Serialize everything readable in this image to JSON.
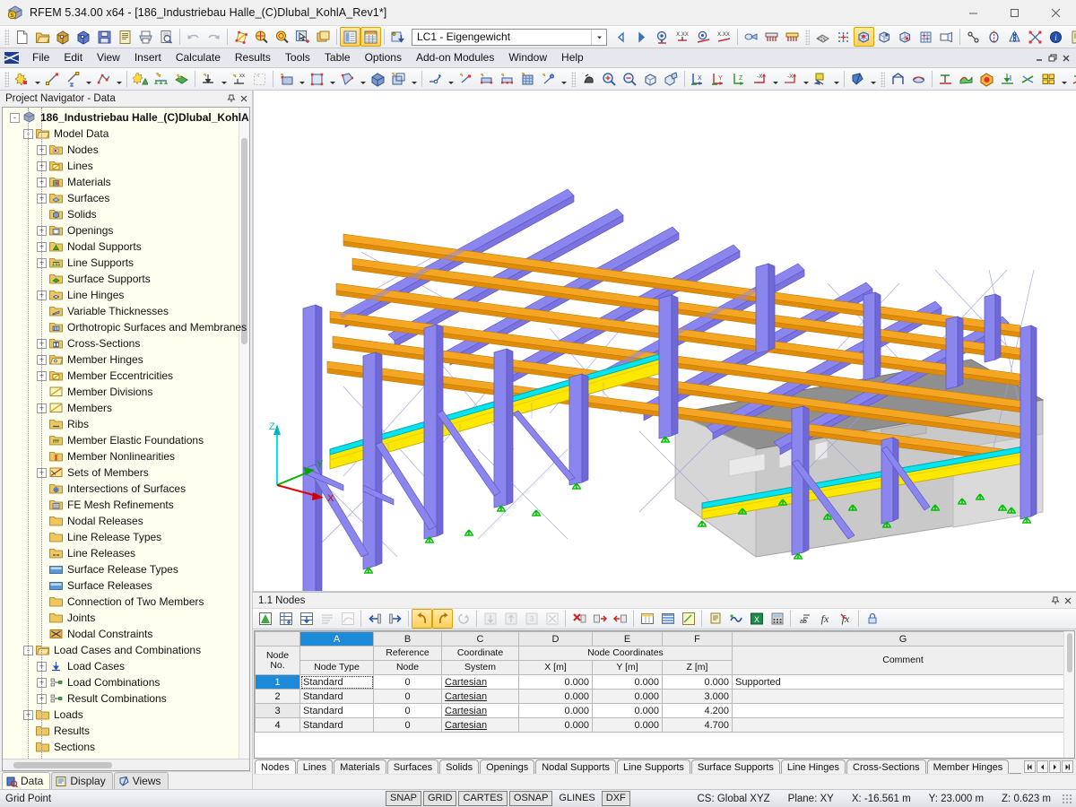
{
  "window": {
    "title": "RFEM 5.34.00 x64 - [186_Industriebau Halle_(C)Dlubal_KohlA_Rev1*]",
    "minimize": "—",
    "maximize": "□",
    "close": "✕"
  },
  "menu": {
    "items": [
      {
        "label": "File"
      },
      {
        "label": "Edit"
      },
      {
        "label": "View"
      },
      {
        "label": "Insert"
      },
      {
        "label": "Calculate"
      },
      {
        "label": "Results"
      },
      {
        "label": "Tools"
      },
      {
        "label": "Table"
      },
      {
        "label": "Options"
      },
      {
        "label": "Add-on Modules"
      },
      {
        "label": "Window"
      },
      {
        "label": "Help"
      }
    ],
    "mdi": {
      "minimize": "–",
      "restore": "❐",
      "close": "✕"
    }
  },
  "toolbar": {
    "load_case_value": "LC1 - Eigengewicht",
    "load_case_dropdown": "▼",
    "prev_label": "◁",
    "next_label": "▷"
  },
  "navigator": {
    "title": "Project Navigator - Data",
    "pin": "⚑",
    "close": "✕",
    "tree": [
      {
        "level": 0,
        "label": "186_Industriebau Halle_(C)Dlubal_KohlA",
        "icon": "model-icon",
        "expander": "-",
        "bold": true
      },
      {
        "level": 1,
        "label": "Model Data",
        "icon": "folder-open-icon",
        "expander": "-"
      },
      {
        "level": 2,
        "label": "Nodes",
        "icon": "nodes-icon",
        "expander": "+"
      },
      {
        "level": 2,
        "label": "Lines",
        "icon": "lines-icon",
        "expander": "+"
      },
      {
        "level": 2,
        "label": "Materials",
        "icon": "materials-icon",
        "expander": "+"
      },
      {
        "level": 2,
        "label": "Surfaces",
        "icon": "surfaces-icon",
        "expander": "+"
      },
      {
        "level": 2,
        "label": "Solids",
        "icon": "solids-icon",
        "expander": ""
      },
      {
        "level": 2,
        "label": "Openings",
        "icon": "openings-icon",
        "expander": "+"
      },
      {
        "level": 2,
        "label": "Nodal Supports",
        "icon": "nodal-supports-icon",
        "expander": "+"
      },
      {
        "level": 2,
        "label": "Line Supports",
        "icon": "line-supports-icon",
        "expander": "+"
      },
      {
        "level": 2,
        "label": "Surface Supports",
        "icon": "surface-supports-icon",
        "expander": ""
      },
      {
        "level": 2,
        "label": "Line Hinges",
        "icon": "line-hinges-icon",
        "expander": "+"
      },
      {
        "level": 2,
        "label": "Variable Thicknesses",
        "icon": "variable-thicknesses-icon",
        "expander": ""
      },
      {
        "level": 2,
        "label": "Orthotropic Surfaces and Membranes",
        "icon": "orthotropic-icon",
        "expander": ""
      },
      {
        "level": 2,
        "label": "Cross-Sections",
        "icon": "cross-sections-icon",
        "expander": "+"
      },
      {
        "level": 2,
        "label": "Member Hinges",
        "icon": "member-hinges-icon",
        "expander": "+"
      },
      {
        "level": 2,
        "label": "Member Eccentricities",
        "icon": "member-eccentricities-icon",
        "expander": "+"
      },
      {
        "level": 2,
        "label": "Member Divisions",
        "icon": "member-divisions-icon",
        "expander": ""
      },
      {
        "level": 2,
        "label": "Members",
        "icon": "members-icon",
        "expander": "+"
      },
      {
        "level": 2,
        "label": "Ribs",
        "icon": "ribs-icon",
        "expander": ""
      },
      {
        "level": 2,
        "label": "Member Elastic Foundations",
        "icon": "member-elastic-foundations-icon",
        "expander": ""
      },
      {
        "level": 2,
        "label": "Member Nonlinearities",
        "icon": "member-nonlinearities-icon",
        "expander": ""
      },
      {
        "level": 2,
        "label": "Sets of Members",
        "icon": "sets-of-members-icon",
        "expander": "+"
      },
      {
        "level": 2,
        "label": "Intersections of Surfaces",
        "icon": "intersections-icon",
        "expander": ""
      },
      {
        "level": 2,
        "label": "FE Mesh Refinements",
        "icon": "fe-mesh-refinements-icon",
        "expander": ""
      },
      {
        "level": 2,
        "label": "Nodal Releases",
        "icon": "folder-icon",
        "expander": ""
      },
      {
        "level": 2,
        "label": "Line Release Types",
        "icon": "folder-icon",
        "expander": ""
      },
      {
        "level": 2,
        "label": "Line Releases",
        "icon": "line-releases-icon",
        "expander": ""
      },
      {
        "level": 2,
        "label": "Surface Release Types",
        "icon": "surface-release-types-icon",
        "expander": ""
      },
      {
        "level": 2,
        "label": "Surface Releases",
        "icon": "surface-releases-icon",
        "expander": ""
      },
      {
        "level": 2,
        "label": "Connection of Two Members",
        "icon": "folder-icon",
        "expander": ""
      },
      {
        "level": 2,
        "label": "Joints",
        "icon": "folder-icon",
        "expander": ""
      },
      {
        "level": 2,
        "label": "Nodal Constraints",
        "icon": "nodal-constraints-icon",
        "expander": ""
      },
      {
        "level": 1,
        "label": "Load Cases and Combinations",
        "icon": "folder-open-icon",
        "expander": "-"
      },
      {
        "level": 2,
        "label": "Load Cases",
        "icon": "load-cases-icon",
        "expander": "+"
      },
      {
        "level": 2,
        "label": "Load Combinations",
        "icon": "load-combinations-icon",
        "expander": "+"
      },
      {
        "level": 2,
        "label": "Result Combinations",
        "icon": "result-combinations-icon",
        "expander": "+"
      },
      {
        "level": 1,
        "label": "Loads",
        "icon": "folder-icon",
        "expander": "+"
      },
      {
        "level": 1,
        "label": "Results",
        "icon": "folder-icon",
        "expander": ""
      },
      {
        "level": 1,
        "label": "Sections",
        "icon": "folder-icon",
        "expander": ""
      }
    ],
    "tabs": [
      {
        "label": "Data",
        "icon": "data-icon",
        "selected": true
      },
      {
        "label": "Display",
        "icon": "display-icon",
        "selected": false
      },
      {
        "label": "Views",
        "icon": "views-icon",
        "selected": false
      }
    ]
  },
  "table": {
    "title": "1.1 Nodes",
    "pin": "⚑",
    "close": "✕",
    "col_letters": [
      "A",
      "B",
      "C",
      "D",
      "E",
      "F",
      "G"
    ],
    "group_header": "Node Coordinates",
    "headers": {
      "rowno": [
        "Node",
        "No."
      ],
      "a": [
        "",
        "Node Type"
      ],
      "b": [
        "Reference",
        "Node"
      ],
      "c": [
        "Coordinate",
        "System"
      ],
      "d": "X [m]",
      "e": "Y [m]",
      "f": "Z [m]",
      "g": "Comment"
    },
    "rows": [
      {
        "no": "1",
        "type": "Standard",
        "ref": "0",
        "sys": "Cartesian",
        "x": "0.000",
        "y": "0.000",
        "z": "0.000",
        "comment": "Supported"
      },
      {
        "no": "2",
        "type": "Standard",
        "ref": "0",
        "sys": "Cartesian",
        "x": "0.000",
        "y": "0.000",
        "z": "3.000",
        "comment": ""
      },
      {
        "no": "3",
        "type": "Standard",
        "ref": "0",
        "sys": "Cartesian",
        "x": "0.000",
        "y": "0.000",
        "z": "4.200",
        "comment": ""
      },
      {
        "no": "4",
        "type": "Standard",
        "ref": "0",
        "sys": "Cartesian",
        "x": "0.000",
        "y": "0.000",
        "z": "4.700",
        "comment": ""
      }
    ],
    "sheet_tabs": [
      {
        "label": "Nodes",
        "selected": true
      },
      {
        "label": "Lines",
        "selected": false
      },
      {
        "label": "Materials",
        "selected": false
      },
      {
        "label": "Surfaces",
        "selected": false
      },
      {
        "label": "Solids",
        "selected": false
      },
      {
        "label": "Openings",
        "selected": false
      },
      {
        "label": "Nodal Supports",
        "selected": false
      },
      {
        "label": "Line Supports",
        "selected": false
      },
      {
        "label": "Surface Supports",
        "selected": false
      },
      {
        "label": "Line Hinges",
        "selected": false
      },
      {
        "label": "Cross-Sections",
        "selected": false
      },
      {
        "label": "Member Hinges",
        "selected": false
      }
    ],
    "nav_first": "⏮",
    "nav_prev": "◀",
    "nav_next": "▶",
    "nav_last": "⏭"
  },
  "viewport": {
    "axis_z": "Z",
    "axis_y": "Y",
    "axis_x": "X",
    "colors": {
      "member_steel": "#7b74e8",
      "purlin_orange": "#f5a623",
      "crane_yellow": "#ffe800",
      "crane_rail_cyan": "#00e5f0",
      "concrete_gray": "#c8c8c8",
      "concrete_dark": "#8f8f8f",
      "support_green": "#00c000",
      "background": "#ffffff"
    }
  },
  "status": {
    "message": "Grid Point",
    "flags": [
      {
        "label": "SNAP",
        "on": true
      },
      {
        "label": "GRID",
        "on": true
      },
      {
        "label": "CARTES",
        "on": true
      },
      {
        "label": "OSNAP",
        "on": true
      },
      {
        "label": "GLINES",
        "on": false
      },
      {
        "label": "DXF",
        "on": true
      }
    ],
    "cs": "CS: Global XYZ",
    "plane": "Plane: XY",
    "x": "X:  -16.561 m",
    "y": "Y:  23.000 m",
    "z": "Z:  0.623 m"
  }
}
